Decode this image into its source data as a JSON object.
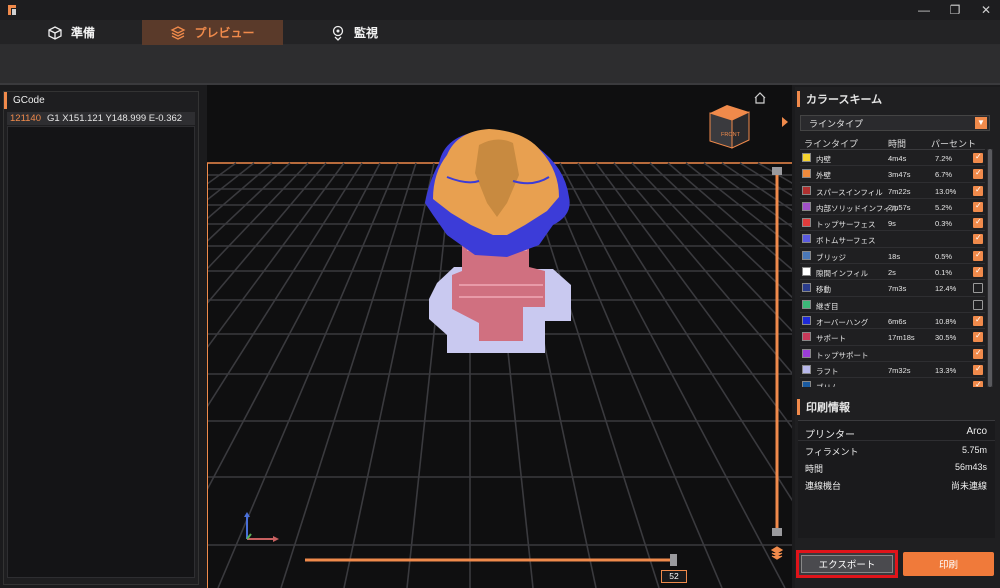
{
  "window": {
    "minimize": "—",
    "restore": "❐",
    "close": "✕"
  },
  "tabs": [
    {
      "label": "準備",
      "icon": "cube-outline-icon"
    },
    {
      "label": "プレビュー",
      "icon": "layers-icon"
    },
    {
      "label": "監視",
      "icon": "location-pin-icon"
    }
  ],
  "gcode": {
    "title": "GCode",
    "line_number": "121140",
    "line_text": "G1 X151.121 Y148.999 E-0.362"
  },
  "viewcube": {
    "label": "FRONT"
  },
  "layer_slider": {
    "current_layer": "52"
  },
  "color_scheme": {
    "title": "カラースキーム",
    "selected": "ラインタイプ",
    "headers": {
      "type": "ラインタイプ",
      "time": "時間",
      "percent": "パーセント"
    },
    "rows": [
      {
        "name": "内壁",
        "time": "4m4s",
        "percent": "7.2%",
        "color": "#f5d430",
        "checked": true
      },
      {
        "name": "外壁",
        "time": "3m47s",
        "percent": "6.7%",
        "color": "#f08a3c",
        "checked": true
      },
      {
        "name": "スパースインフィル",
        "time": "7m22s",
        "percent": "13.0%",
        "color": "#b03030",
        "checked": true
      },
      {
        "name": "内部ソリッドインフィル",
        "time": "2m57s",
        "percent": "5.2%",
        "color": "#a050c8",
        "checked": true
      },
      {
        "name": "トップサーフェス",
        "time": "9s",
        "percent": "0.3%",
        "color": "#e03c3c",
        "checked": true
      },
      {
        "name": "ボトムサーフェス",
        "time": "",
        "percent": "",
        "color": "#5a5ae0",
        "checked": true
      },
      {
        "name": "ブリッジ",
        "time": "18s",
        "percent": "0.5%",
        "color": "#4a78b8",
        "checked": true
      },
      {
        "name": "隙間インフィル",
        "time": "2s",
        "percent": "0.1%",
        "color": "#ffffff",
        "checked": true
      },
      {
        "name": "移動",
        "time": "7m3s",
        "percent": "12.4%",
        "color": "#2a3c8c",
        "checked": false
      },
      {
        "name": "継ぎ目",
        "time": "",
        "percent": "",
        "color": "#3cb878",
        "checked": false
      },
      {
        "name": "オーバーハング",
        "time": "6m6s",
        "percent": "10.8%",
        "color": "#1e2ad8",
        "checked": true
      },
      {
        "name": "サポート",
        "time": "17m18s",
        "percent": "30.5%",
        "color": "#c83a5a",
        "checked": true
      },
      {
        "name": "トップサポート",
        "time": "",
        "percent": "",
        "color": "#9b3cd8",
        "checked": true
      },
      {
        "name": "ラフト",
        "time": "7m32s",
        "percent": "13.3%",
        "color": "#b8b8ea",
        "checked": true
      },
      {
        "name": "ブリム",
        "time": "",
        "percent": "",
        "color": "#1a5aa0",
        "checked": true
      }
    ]
  },
  "print_info": {
    "title": "印刷情報",
    "printer_label": "プリンター",
    "printer_value": "Arco",
    "filament_label": "フィラメント",
    "filament_value": "5.75m",
    "time_label": "時間",
    "time_value": "56m43s",
    "link_label": "連線機台",
    "link_value": "尚未連線"
  },
  "buttons": {
    "export": "エクスポート",
    "print": "印刷"
  },
  "colors": {
    "accent": "#f08a4b",
    "export_highlight": "#e0141a"
  }
}
